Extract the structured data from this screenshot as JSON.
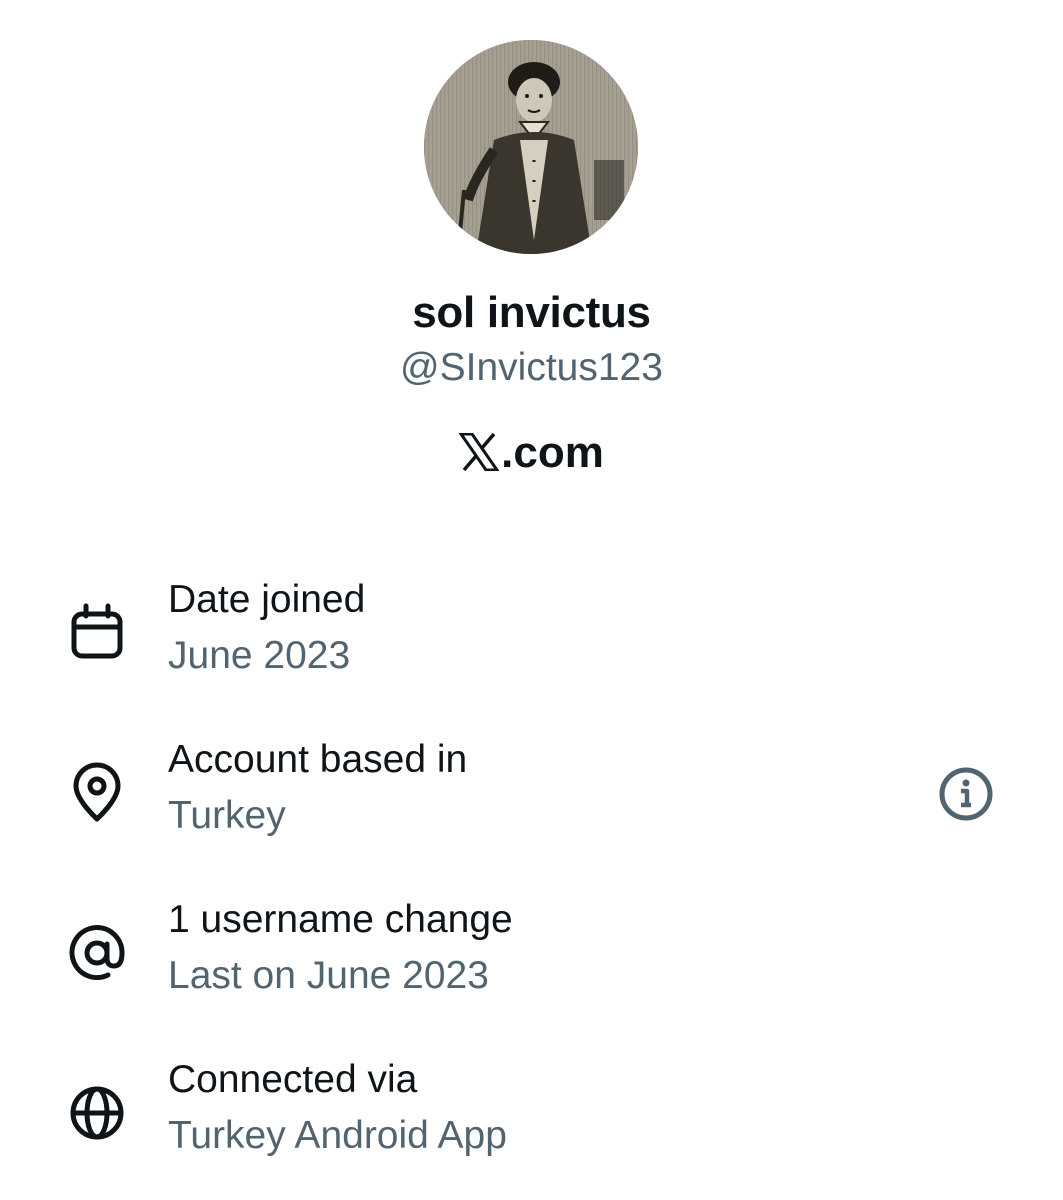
{
  "profile": {
    "display_name": "sol invictus",
    "handle": "@SInvictus123",
    "brand": ".com",
    "avatar_icon": "avatar-engraving-portrait"
  },
  "details": [
    {
      "icon": "calendar-icon",
      "title": "Date joined",
      "value": "June 2023"
    },
    {
      "icon": "location-pin-icon",
      "title": "Account based in",
      "value": "Turkey",
      "action_icon": "info-icon"
    },
    {
      "icon": "at-sign-icon",
      "title": "1 username change",
      "value": "Last on June 2023"
    },
    {
      "icon": "globe-icon",
      "title": "Connected via",
      "value": "Turkey Android App"
    }
  ],
  "colors": {
    "primary_text": "#0f1419",
    "secondary_text": "#536471",
    "background": "#ffffff"
  }
}
